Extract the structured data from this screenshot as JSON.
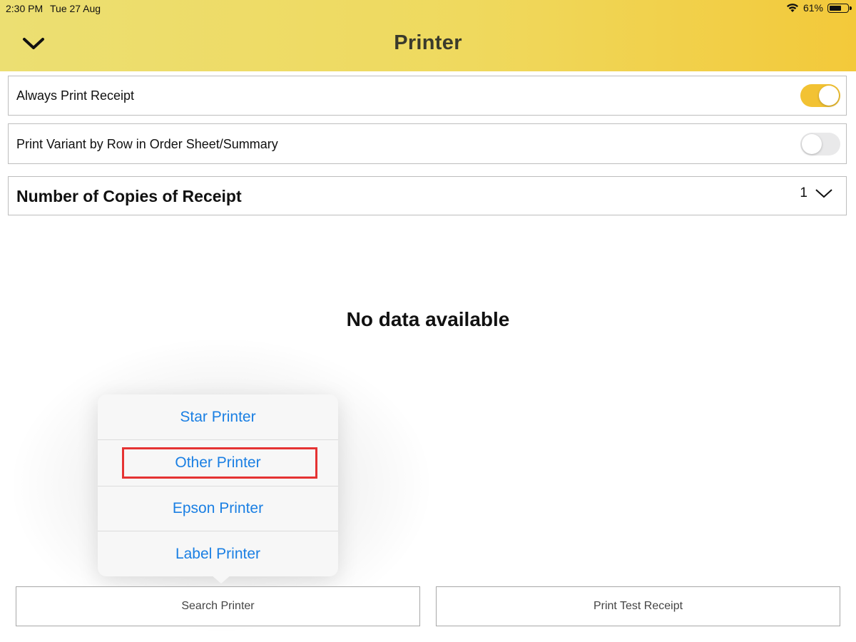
{
  "status_bar": {
    "time": "2:30 PM",
    "date": "Tue 27 Aug",
    "battery": "61%"
  },
  "header": {
    "title": "Printer",
    "back_icon": "chevron-down-icon"
  },
  "settings": {
    "always_print_receipt": {
      "label": "Always Print Receipt",
      "enabled": true
    },
    "print_variant_by_row": {
      "label": "Print Variant by Row in Order Sheet/Summary",
      "enabled": false
    },
    "copies": {
      "label": "Number of Copies of Receipt",
      "value": "1"
    }
  },
  "empty_state": "No data available",
  "printer_menu": {
    "items": [
      "Star Printer",
      "Other Printer",
      "Epson Printer",
      "Label Printer"
    ],
    "highlighted": "Other Printer",
    "text_color": "#1a7fe3"
  },
  "buttons": {
    "search_printer": "Search Printer",
    "print_test_receipt": "Print Test Receipt"
  },
  "colors": {
    "accent": "#f2c233",
    "highlight": "#e53333"
  }
}
